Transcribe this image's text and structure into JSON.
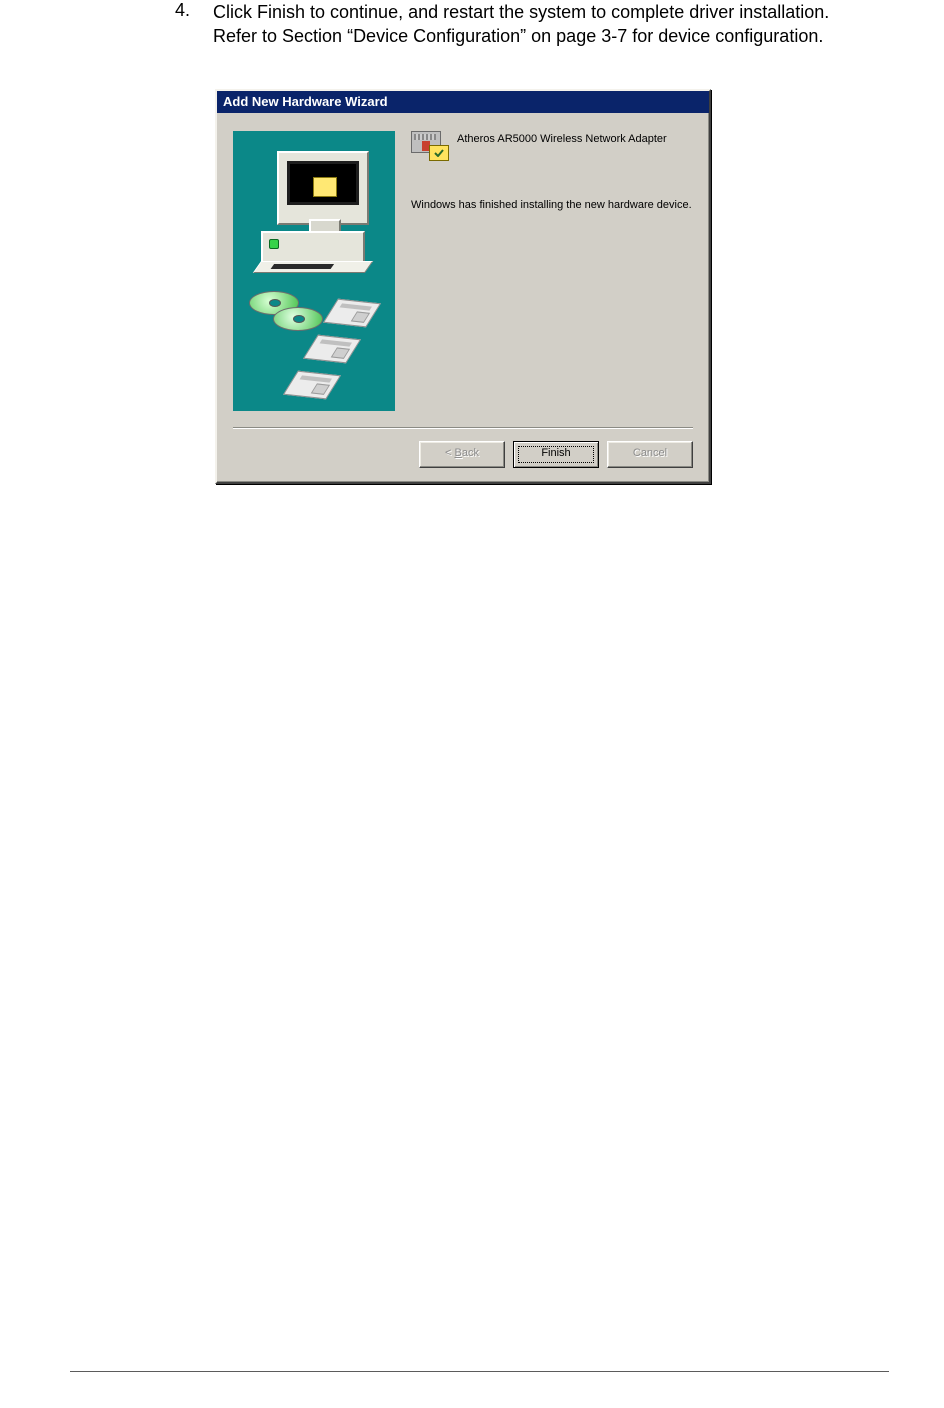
{
  "instruction": {
    "number": "4.",
    "text": "Click Finish to continue, and restart the system to complete driver installation. Refer to Section “Device Configuration” on page 3-7 for device configuration."
  },
  "dialog": {
    "title": "Add New Hardware Wizard",
    "device_name": "Atheros AR5000 Wireless Network Adapter",
    "message": "Windows has finished installing the new hardware device.",
    "buttons": {
      "back_prefix": "< ",
      "back_accel": "B",
      "back_suffix": "ack",
      "finish": "Finish",
      "cancel": "Cancel"
    }
  }
}
